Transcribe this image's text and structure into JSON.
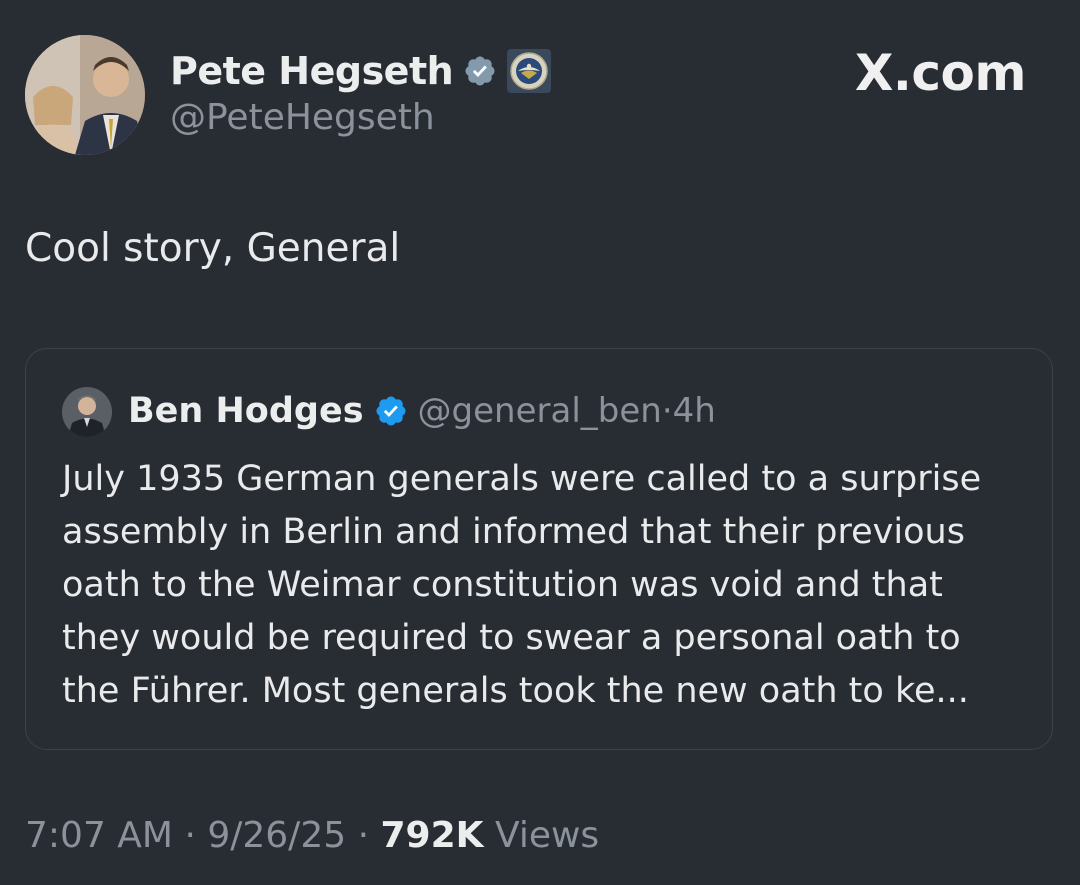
{
  "author": {
    "display_name": "Pete Hegseth",
    "handle": "@PeteHegseth",
    "verified_badge_icon": "verified-badge-gray-icon",
    "affiliate_badge_icon": "department-seal-icon"
  },
  "brand": {
    "label": "X.com"
  },
  "tweet": {
    "text": "Cool story, General"
  },
  "quote": {
    "display_name": "Ben Hodges",
    "handle": "@general_ben",
    "separator": "·",
    "age": "4h",
    "verified_badge_icon": "verified-badge-blue-icon",
    "lines": [
      "July 1935 German generals were called to a surprise",
      "assembly in Berlin and informed that their previous",
      "oath to the Weimar constitution was void and that",
      "they would be required to swear a personal oath to",
      "the Führer. Most generals took the new oath to ke..."
    ]
  },
  "footer": {
    "time": "7:07 AM",
    "sep1": "·",
    "date": "9/26/25",
    "sep2": "·",
    "views_count": "792K",
    "views_label": "Views"
  },
  "colors": {
    "background": "#282c33",
    "text": "#e9eaeb",
    "muted": "#8b929c",
    "verified_blue": "#1d9bf0",
    "verified_gray": "#829aab"
  }
}
